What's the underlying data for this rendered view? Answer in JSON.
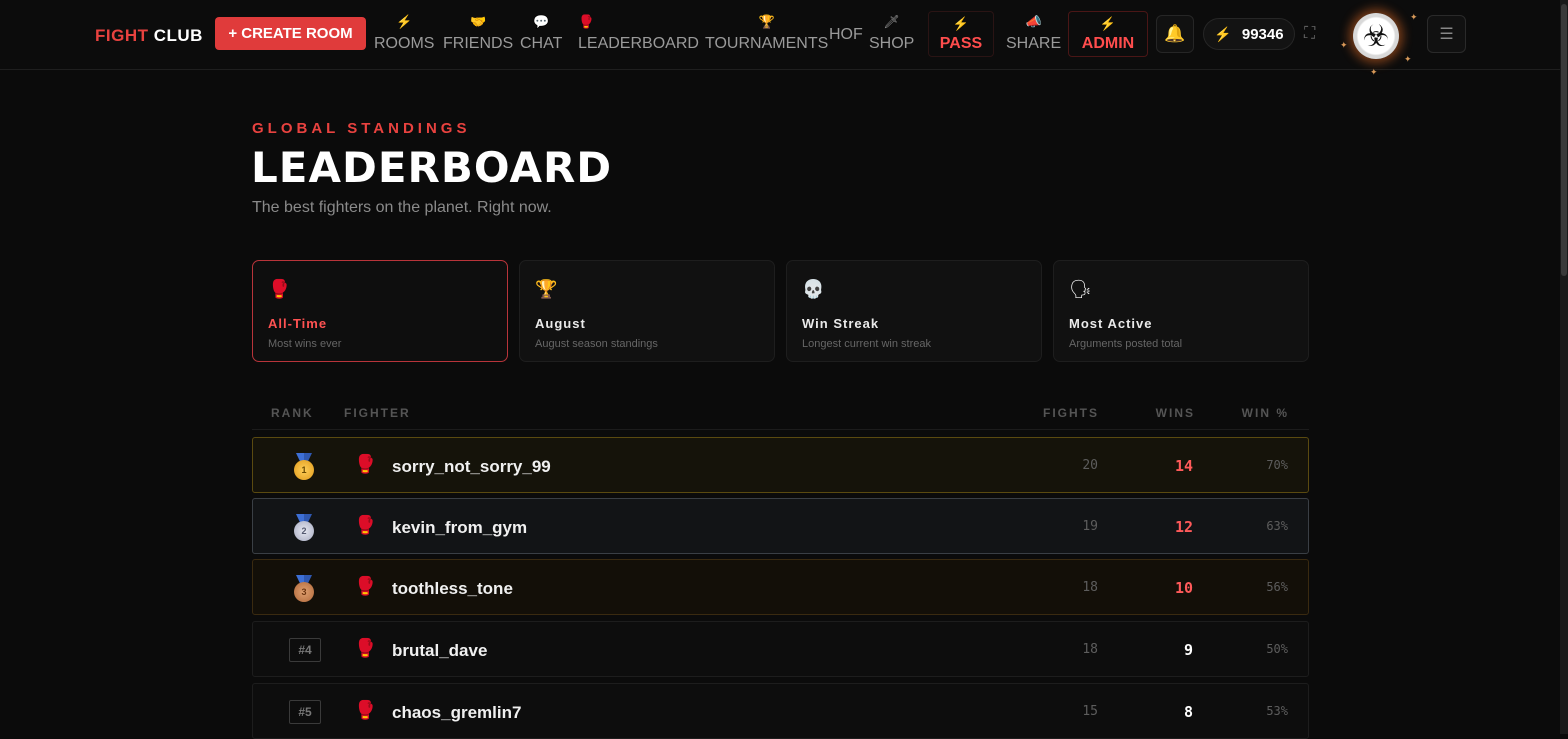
{
  "nav": {
    "logo_a": "FIGHT",
    "logo_b": "CLUB",
    "create_room": "+ CREATE ROOM",
    "items": [
      {
        "label": "ROOMS",
        "icon": "⚡",
        "icon_name": "bolt-icon"
      },
      {
        "label": "FRIENDS",
        "icon": "🤝",
        "icon_name": "handshake-icon"
      },
      {
        "label": "CHAT",
        "icon": "💬",
        "icon_name": "speech-bubble-icon"
      },
      {
        "label": "LEADERBOARD",
        "icon": "🥊",
        "icon_name": "boxing-glove-icon"
      },
      {
        "label": "TOURNAMENTS",
        "icon": "🏆",
        "icon_name": "trophy-icon"
      },
      {
        "label": "HOF",
        "icon": "",
        "icon_name": ""
      },
      {
        "label": "SHOP",
        "icon": "🗡",
        "icon_name": "dagger-icon"
      },
      {
        "label": "PASS",
        "icon": "⚡",
        "icon_name": "bolt-icon"
      },
      {
        "label": "SHARE",
        "icon": "📣",
        "icon_name": "megaphone-icon"
      },
      {
        "label": "ADMIN",
        "icon": "⚡",
        "icon_name": "bolt-icon"
      }
    ],
    "coins": "99346",
    "accent": "#e8423f"
  },
  "header": {
    "eyebrow": "GLOBAL STANDINGS",
    "title": "LEADERBOARD",
    "subtitle": "The best fighters on the planet. Right now."
  },
  "categories": [
    {
      "name": "All-Time",
      "desc": "Most wins ever",
      "icon": "🥊",
      "active": true
    },
    {
      "name": "August",
      "desc": "August season standings",
      "icon": "🏆",
      "active": false
    },
    {
      "name": "Win Streak",
      "desc": "Longest current win streak",
      "icon": "💀",
      "active": false
    },
    {
      "name": "Most Active",
      "desc": "Arguments posted total",
      "icon": "🗣",
      "active": false
    }
  ],
  "table": {
    "headers": {
      "rank": "RANK",
      "fighter": "FIGHTER",
      "fights": "FIGHTS",
      "wins": "WINS",
      "pct": "WIN %"
    },
    "rows": [
      {
        "rank": "1",
        "name": "sorry_not_sorry_99",
        "fights": "20",
        "wins": "14",
        "pct": "70%"
      },
      {
        "rank": "2",
        "name": "kevin_from_gym",
        "fights": "19",
        "wins": "12",
        "pct": "63%"
      },
      {
        "rank": "3",
        "name": "toothless_tone",
        "fights": "18",
        "wins": "10",
        "pct": "56%"
      },
      {
        "rank": "#4",
        "name": "brutal_dave",
        "fights": "18",
        "wins": "9",
        "pct": "50%"
      },
      {
        "rank": "#5",
        "name": "chaos_gremlin7",
        "fights": "15",
        "wins": "8",
        "pct": "53%"
      }
    ]
  }
}
